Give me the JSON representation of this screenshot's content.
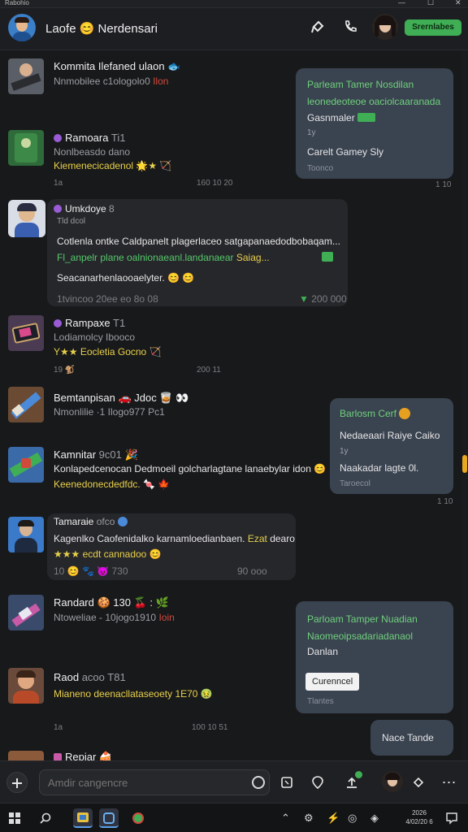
{
  "window": {
    "title": "Rabohio",
    "min_glyph": "—",
    "max_glyph": "☐",
    "close_glyph": "✕"
  },
  "header": {
    "title": "Laofe 😊 Nerdensari",
    "status_label": "Srernlabes",
    "icons": [
      "pin-icon",
      "phone-icon"
    ]
  },
  "feed": {
    "posts": [
      {
        "name": "Kommita Ilefaned ulaon 🐟",
        "line1": "Nnmobilee c1ologolo0",
        "line1_accent": "Ilon",
        "meta_left": "",
        "meta_right": ""
      },
      {
        "name": "Ramoara",
        "name_suffix": "Ti1",
        "line1": "Nonlbeasdo dano",
        "line2": "Kiemenecicadenol 🌟★ 🏹",
        "meta_left": "1a",
        "meta_right": "160 10 20"
      },
      {
        "name": "Rampaxe",
        "name_suffix": "T1",
        "line1": "Lodiamolcy Ibooco",
        "line2": "Y★★ Eocletia Gocno 🏹",
        "meta_left": "19  🐒",
        "meta_right": "200 11"
      },
      {
        "name": "Bemtanpisan 🚗 Jdoc 🥃 👀",
        "line1": "Nmonlilie ·1 Ilogo977 Pc1",
        "meta_left": "",
        "meta_right": ""
      },
      {
        "name": "Kamnitar",
        "name_suffix": "9c01 🎉",
        "line1": "Konlapedcenocan Dedmoeil golcharlagtane lanaebylar idon 😊",
        "line2": "Keenedonecdedfdc. 🍬 🍁",
        "meta_left": "",
        "meta_right": ""
      },
      {
        "name": "Randard 🍪 130 🍒 : 🌿",
        "line1": "Ntoweliae - 10jogo1910",
        "line1_accent": "Ioin",
        "meta_left": "",
        "meta_right": ""
      },
      {
        "name": "Raod",
        "name_suffix": "acoo  T81",
        "line1": "Mianeno deenacllataseoety 1E70 🤢",
        "meta_left": "1a",
        "meta_right": "100 10 51"
      },
      {
        "name": "Repiar 🍰",
        "line1": "",
        "meta_left": "",
        "meta_right": ""
      }
    ],
    "cards": [
      {
        "name": "Umkdoye",
        "name_suffix": "8",
        "sub": "Tld dcol",
        "line1": "Cotlenla ontke Caldpanelt plagerlaceo satgapanaedodbobaqam...",
        "line2a": "Fl_anpelr plane oalnionaeanl.landanaear",
        "line2b": "Saiag...",
        "line3": "Seacanarhenlaooaelyter. 😊 😊",
        "meta_left": "1tvincoo   20ee eo 8o 08",
        "meta_right": "200 000"
      },
      {
        "name": "Tamaraie",
        "name_suffix": "ofco",
        "line1": "Kagenlko Caofenidalko karnamloedianbaen.",
        "line1b": "Ezat",
        "line1c": "dearo",
        "line2": "★★★ ecdt  cannadoo 😊",
        "meta_left": "10  😊  🐾  😈  730",
        "meta_right": "90  ooo"
      }
    ],
    "bubbles": [
      {
        "line1": "Parleam Tamer Nosdilan",
        "line2": "leonedeoteoe oaciolcaaranada",
        "line3": "Gasnmaler",
        "line4": "1y",
        "line5": "Carelt Gamey Sly",
        "line6": "Toonco",
        "time": "1 10"
      },
      {
        "line1": "Barlosm Cerf",
        "line2": "Nedaeaari Raiye Caiko",
        "line3": "1y",
        "line4": "Naakadar lagte 0l.",
        "line5": "Taroecol",
        "time": "1 10"
      },
      {
        "line1": "Parloam Tamper Nuadian",
        "line2": "Naomeoipsadariadanaol",
        "line3": "Danlan",
        "chip": "Curenncel",
        "line4": "Tlantes",
        "time": ""
      },
      {
        "line1": "Nace Tande",
        "time": ""
      }
    ]
  },
  "composer": {
    "placeholder": "Amdir cangencre",
    "icons": [
      "plus-icon",
      "refresh-icon",
      "square-icon",
      "location-icon",
      "upload-icon",
      "avatar",
      "tag-icon",
      "more-icon"
    ]
  },
  "taskbar": {
    "time_top": "2026",
    "time_bottom": "4/02/20 6"
  },
  "colors": {
    "background": "#18191b",
    "bubble": "#3a4350",
    "card": "#26272b",
    "accent_green": "#3fae55",
    "accent_yellow": "#e8d04a",
    "accent_red": "#d04a3c",
    "scroll_thumb": "#e8a820"
  }
}
